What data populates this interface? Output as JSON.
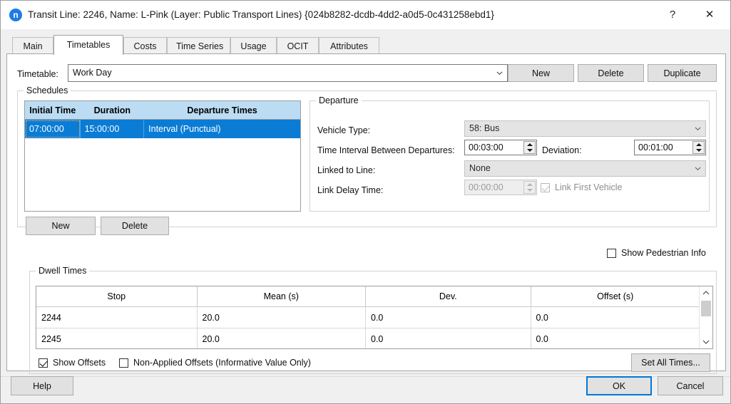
{
  "window": {
    "icon": "app-icon-n",
    "icon_letter": "n",
    "title": "Transit Line: 2246, Name: L-Pink (Layer: Public Transport Lines) {024b8282-dcdb-4dd2-a0d5-0c431258ebd1}",
    "help_glyph": "?",
    "close_glyph": "✕"
  },
  "tabs": [
    {
      "label": "Main",
      "active": false
    },
    {
      "label": "Timetables",
      "active": true
    },
    {
      "label": "Costs",
      "active": false
    },
    {
      "label": "Time Series",
      "active": false
    },
    {
      "label": "Usage",
      "active": false
    },
    {
      "label": "OCIT",
      "active": false
    },
    {
      "label": "Attributes",
      "active": false
    }
  ],
  "timetable_row": {
    "label": "Timetable:",
    "value": "Work Day",
    "new_label": "New",
    "delete_label": "Delete",
    "duplicate_label": "Duplicate"
  },
  "schedules": {
    "group_title": "Schedules",
    "columns": [
      "Initial Time",
      "Duration",
      "Departure Times"
    ],
    "rows": [
      {
        "initial_time": "07:00:00",
        "duration": "15:00:00",
        "departure_times": "Interval (Punctual)",
        "selected": true
      }
    ],
    "new_label": "New",
    "delete_label": "Delete"
  },
  "departure": {
    "group_title": "Departure",
    "vehicle_type_label": "Vehicle Type:",
    "vehicle_type_value": "58: Bus",
    "interval_label": "Time Interval Between Departures:",
    "interval_value": "00:03:00",
    "deviation_label": "Deviation:",
    "deviation_value": "00:01:00",
    "linked_to_line_label": "Linked to Line:",
    "linked_to_line_value": "None",
    "link_delay_label": "Link Delay Time:",
    "link_delay_value": "00:00:00",
    "link_first_vehicle_label": "Link First Vehicle",
    "link_first_vehicle_checked": true
  },
  "show_pedestrian_info": {
    "label": "Show Pedestrian Info",
    "checked": false
  },
  "dwell_times": {
    "group_title": "Dwell Times",
    "columns": [
      "Stop",
      "Mean (s)",
      "Dev.",
      "Offset (s)"
    ],
    "rows": [
      {
        "stop": "2244",
        "mean": "20.0",
        "dev": "0.0",
        "offset": "0.0"
      },
      {
        "stop": "2245",
        "mean": "20.0",
        "dev": "0.0",
        "offset": "0.0"
      }
    ],
    "show_offsets_label": "Show Offsets",
    "show_offsets_checked": true,
    "non_applied_label": "Non-Applied Offsets (Informative Value Only)",
    "non_applied_checked": false,
    "set_all_times_label": "Set All Times..."
  },
  "footer": {
    "help_label": "Help",
    "ok_label": "OK",
    "cancel_label": "Cancel"
  },
  "colors": {
    "accent": "#0078d7",
    "selection": "#0a7cd5",
    "header": "#bcdcf4",
    "dialog_bg": "#f0f0f0"
  }
}
